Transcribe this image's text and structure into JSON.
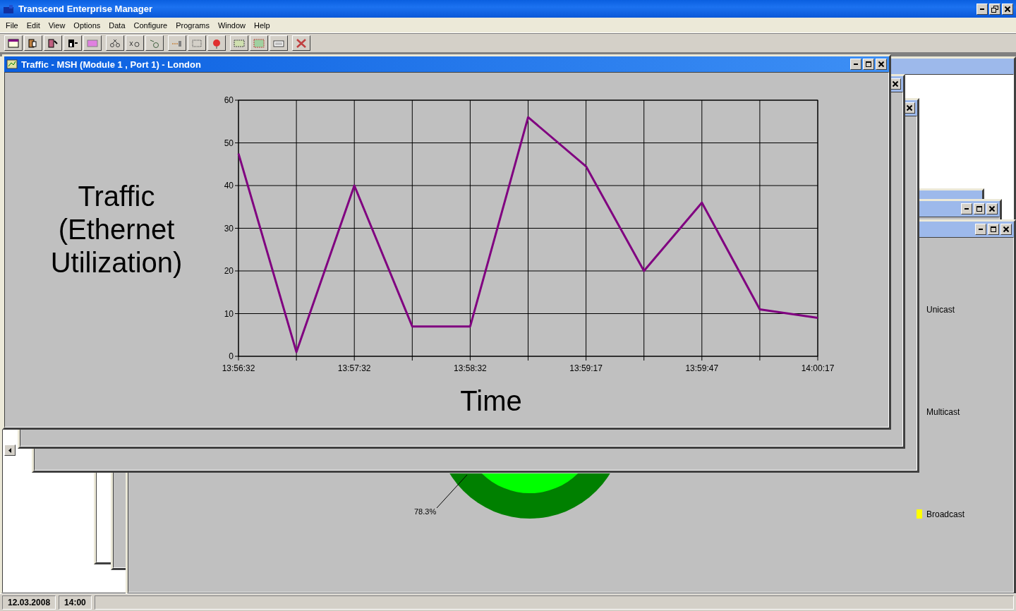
{
  "app": {
    "title": "Transcend Enterprise Manager"
  },
  "menu": [
    "File",
    "Edit",
    "View",
    "Options",
    "Data",
    "Configure",
    "Programs",
    "Window",
    "Help"
  ],
  "traffic_window": {
    "title": "Traffic - MSH (Module 1 , Port 1) - London",
    "chart_data": {
      "type": "line",
      "ylabel": "Traffic (Ethernet Utilization)",
      "xlabel": "Time",
      "categories": [
        "13:56:32",
        null,
        "13:57:32",
        null,
        "13:58:32",
        null,
        "13:59:17",
        null,
        "13:59:47",
        null,
        "14:00:17"
      ],
      "series": [
        {
          "color": "#800080",
          "values": [
            47.5,
            1,
            40,
            7,
            7,
            56,
            44.5,
            20,
            36,
            11,
            9
          ]
        }
      ],
      "ylim": [
        0,
        60
      ],
      "grid": true,
      "yticks": [
        0,
        10,
        20,
        30,
        40,
        50,
        60
      ]
    }
  },
  "donut_window": {
    "slice_label": "78.3%",
    "legend": [
      {
        "label": "Unicast"
      },
      {
        "label": "Multicast"
      },
      {
        "label": "Broadcast",
        "color": "#ffff00"
      }
    ]
  },
  "status_bar": [
    "12.03.2008",
    "14:00"
  ]
}
